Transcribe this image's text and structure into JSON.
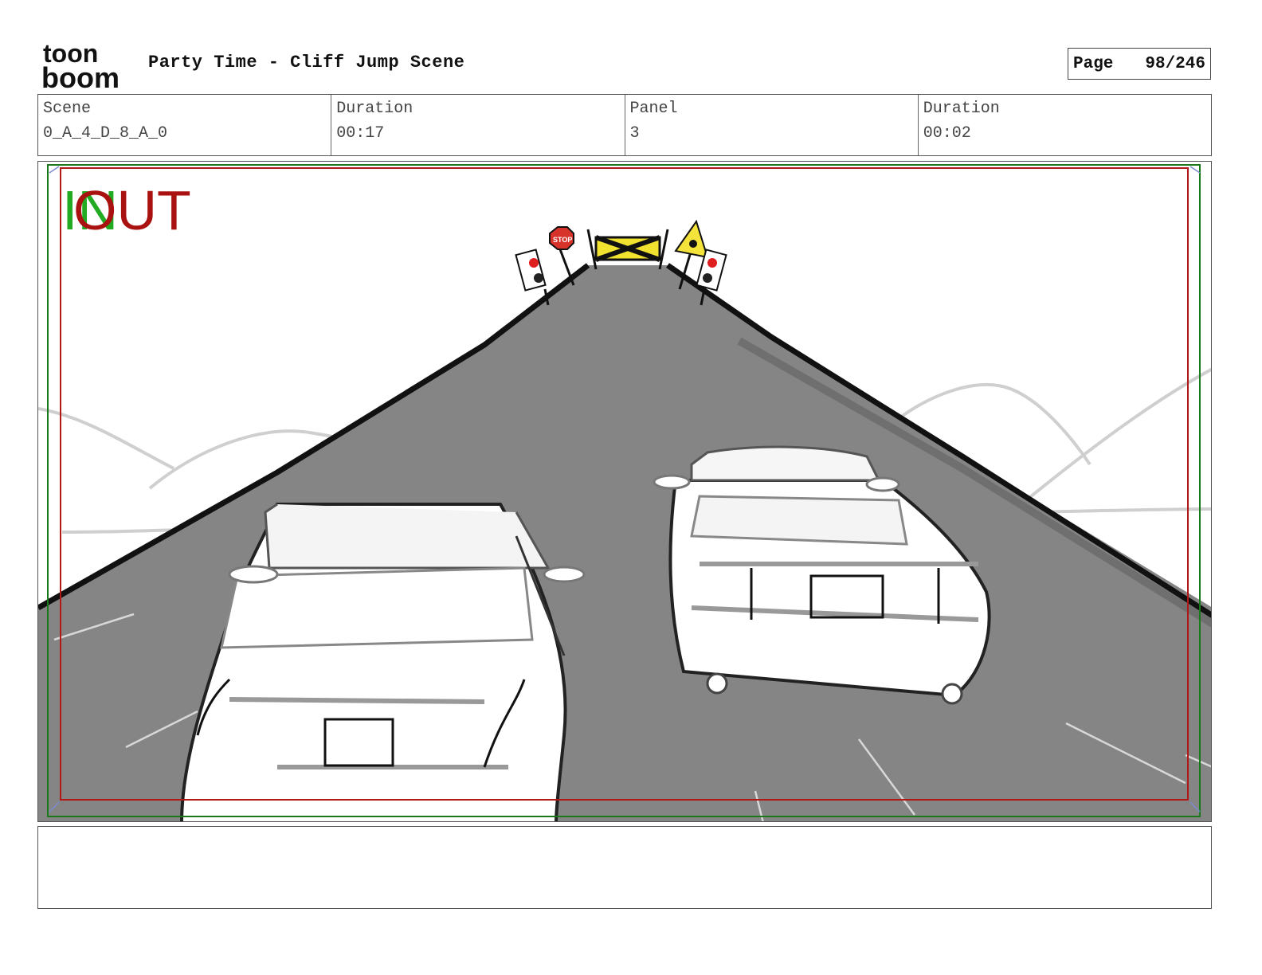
{
  "header": {
    "logo_top": "toon",
    "logo_bottom": "boom",
    "title": "Party Time - Cliff Jump Scene",
    "page_label": "Page",
    "page_value": "98/246"
  },
  "info": {
    "scene_label": "Scene",
    "scene_value": "0_A_4_D_8_A_0",
    "scene_duration_label": "Duration",
    "scene_duration_value": "00:17",
    "panel_label": "Panel",
    "panel_value": "3",
    "panel_duration_label": "Duration",
    "panel_duration_value": "00:02"
  },
  "panel": {
    "in_marker": "IN",
    "out_marker": "OUT",
    "stop_sign_text": "STOP"
  },
  "caption": {
    "text": ""
  },
  "colors": {
    "in_marker": "#22aa22",
    "out_marker": "#aa1111",
    "road": "#858585",
    "safe_area_red": "#b01818",
    "safe_area_green": "#1a7a1a"
  }
}
